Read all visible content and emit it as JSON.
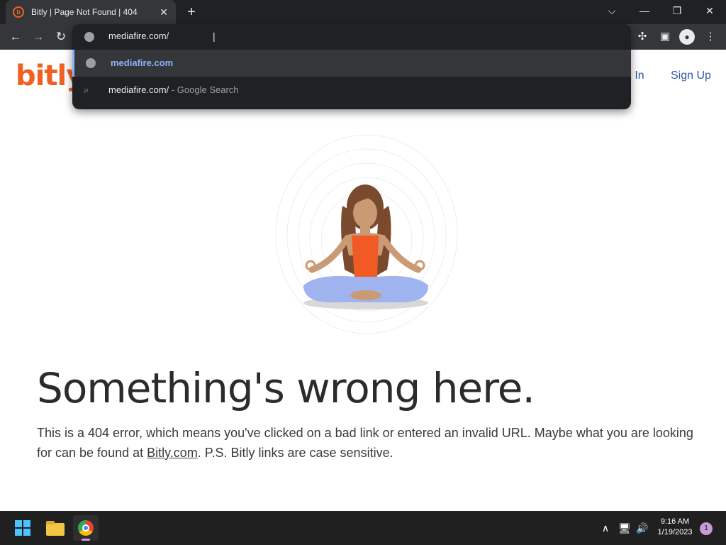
{
  "browser": {
    "tab_title": "Bitly | Page Not Found | 404",
    "tab_close": "✕",
    "new_tab": "+",
    "controls": {
      "dropdown": "⌵",
      "minimize": "—",
      "restore": "❐",
      "close": "✕"
    },
    "nav": {
      "back": "←",
      "forward": "→",
      "reload": "↻"
    },
    "toolbar_icons": {
      "extensions": "✣",
      "side_panel": "▣",
      "menu": "⋮"
    }
  },
  "omnibox": {
    "input_value": "mediafire.com/",
    "suggestions": [
      {
        "icon": "globe-icon",
        "text": "mediafire.com",
        "sub": ""
      },
      {
        "icon": "search-icon",
        "text": "mediafire.com/",
        "sub": " - Google Search"
      }
    ]
  },
  "page": {
    "logo": "bitly",
    "login": "g In",
    "signup": "Sign Up",
    "headline": "Something's wrong here.",
    "body_before": "This is a 404 error, which means you've clicked on a bad link or entered an invalid URL. Maybe what you are looking for can be found at ",
    "body_link": "Bitly.com",
    "body_after": ". P.S. Bitly links are case sensitive."
  },
  "taskbar": {
    "time": "9:16 AM",
    "date": "1/19/2023",
    "notifications": "1",
    "tray": {
      "chevron": "∧",
      "network": "🖥",
      "volume": "🔊"
    }
  },
  "colors": {
    "brand": "#ee6123",
    "link": "#3159a3",
    "chrome_dark": "#202124",
    "chrome_mid": "#35363a"
  }
}
